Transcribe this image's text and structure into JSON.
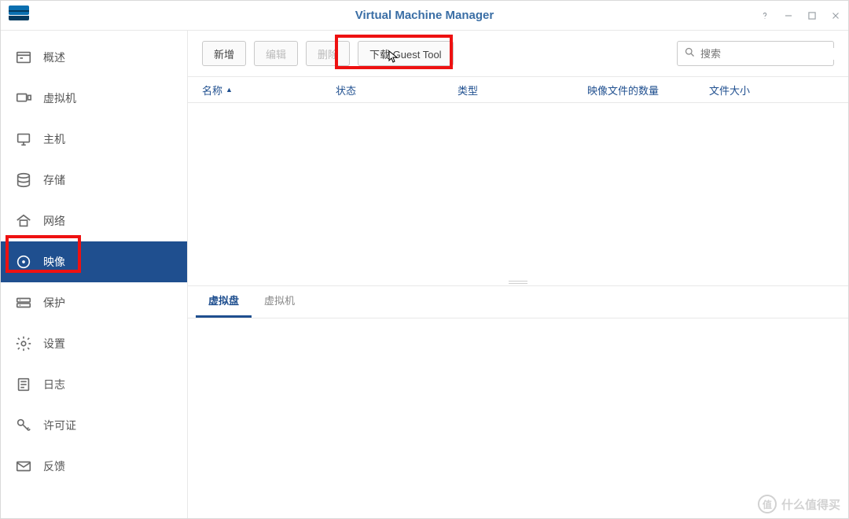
{
  "window": {
    "title": "Virtual Machine Manager"
  },
  "sidebar": {
    "items": [
      {
        "key": "overview",
        "label": "概述"
      },
      {
        "key": "vm",
        "label": "虚拟机"
      },
      {
        "key": "host",
        "label": "主机"
      },
      {
        "key": "storage",
        "label": "存储"
      },
      {
        "key": "network",
        "label": "网络"
      },
      {
        "key": "image",
        "label": "映像",
        "selected": true
      },
      {
        "key": "protect",
        "label": "保护"
      },
      {
        "key": "settings",
        "label": "设置"
      },
      {
        "key": "log",
        "label": "日志"
      },
      {
        "key": "license",
        "label": "许可证"
      },
      {
        "key": "feedback",
        "label": "反馈"
      }
    ]
  },
  "toolbar": {
    "buttons": [
      {
        "key": "add",
        "label": "新增",
        "enabled": true
      },
      {
        "key": "edit",
        "label": "编辑",
        "enabled": false
      },
      {
        "key": "delete",
        "label": "删除",
        "enabled": false
      },
      {
        "key": "guest",
        "label": "下载 Guest Tool",
        "enabled": true,
        "highlighted": true
      }
    ],
    "search_placeholder": "搜索"
  },
  "table": {
    "columns": [
      {
        "key": "name",
        "label": "名称",
        "sort": "asc"
      },
      {
        "key": "status",
        "label": "状态"
      },
      {
        "key": "type",
        "label": "类型"
      },
      {
        "key": "count",
        "label": "映像文件的数量"
      },
      {
        "key": "size",
        "label": "文件大小"
      }
    ],
    "rows": []
  },
  "tabs": {
    "items": [
      {
        "key": "vdisk",
        "label": "虚拟盘",
        "active": true
      },
      {
        "key": "vm",
        "label": "虚拟机",
        "active": false
      }
    ]
  },
  "watermark": {
    "badge": "值",
    "text": "什么值得买"
  }
}
